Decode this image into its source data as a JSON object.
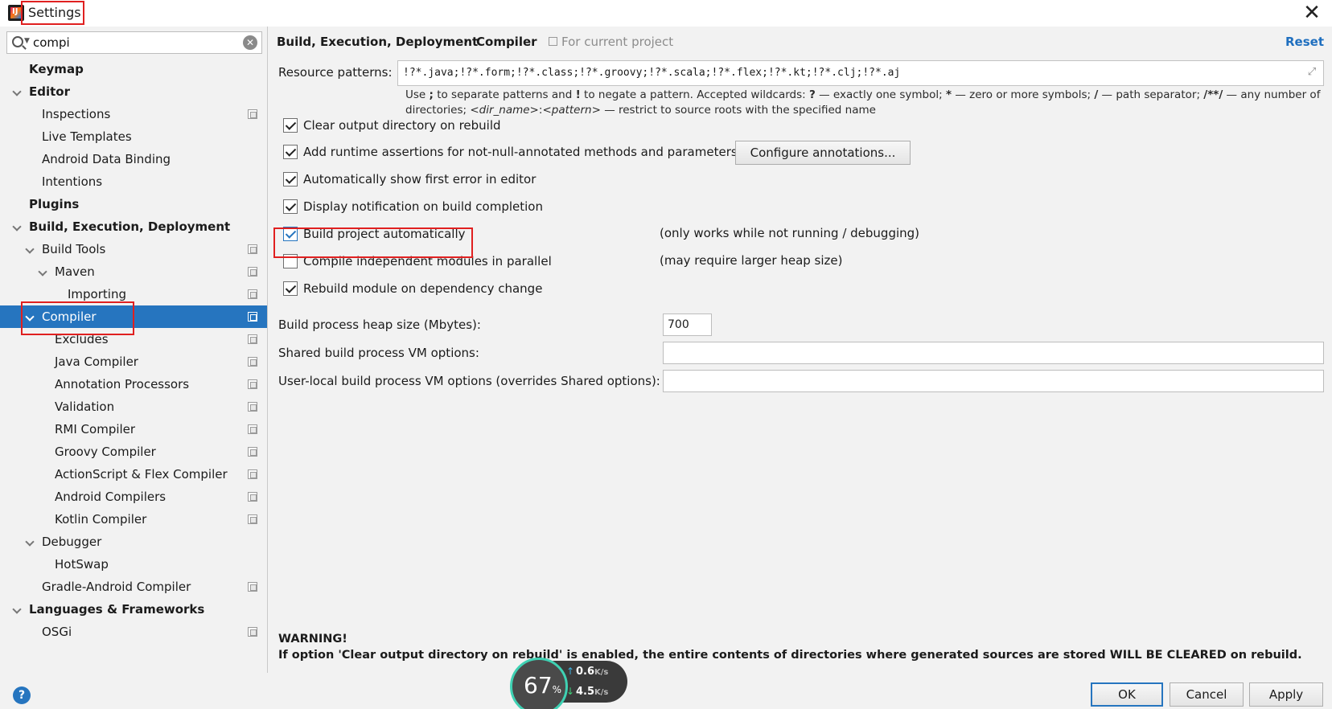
{
  "window": {
    "title": "Settings",
    "close_glyph": "✕"
  },
  "search": {
    "value": "compi",
    "clear_glyph": "✕"
  },
  "tree": [
    {
      "label": "Keymap",
      "bold": true
    },
    {
      "label": "Editor",
      "bold": true
    },
    {
      "label": "Inspections"
    },
    {
      "label": "Live Templates"
    },
    {
      "label": "Android Data Binding"
    },
    {
      "label": "Intentions"
    },
    {
      "label": "Plugins",
      "bold": true
    },
    {
      "label": "Build, Execution, Deployment",
      "bold": true
    },
    {
      "label": "Build Tools"
    },
    {
      "label": "Maven"
    },
    {
      "label": "Importing"
    },
    {
      "label": "Compiler",
      "selected": true
    },
    {
      "label": "Excludes"
    },
    {
      "label": "Java Compiler"
    },
    {
      "label": "Annotation Processors"
    },
    {
      "label": "Validation"
    },
    {
      "label": "RMI Compiler"
    },
    {
      "label": "Groovy Compiler"
    },
    {
      "label": "ActionScript & Flex Compiler"
    },
    {
      "label": "Android Compilers"
    },
    {
      "label": "Kotlin Compiler"
    },
    {
      "label": "Debugger"
    },
    {
      "label": "HotSwap"
    },
    {
      "label": "Gradle-Android Compiler"
    },
    {
      "label": "Languages & Frameworks",
      "bold": true
    },
    {
      "label": "OSGi"
    }
  ],
  "header": {
    "crumb_parent": "Build, Execution, Deployment",
    "crumb_sep": "›",
    "crumb_current": "Compiler",
    "scope": "For current project",
    "reset": "Reset"
  },
  "resource": {
    "label": "Resource patterns:",
    "value": "!?*.java;!?*.form;!?*.class;!?*.groovy;!?*.scala;!?*.flex;!?*.kt;!?*.clj;!?*.aj",
    "expand_glyph": "⤢",
    "hint_1": "Use ",
    "hint_semi": ";",
    "hint_2": " to separate patterns and ",
    "hint_bang": "!",
    "hint_3": " to negate a pattern. Accepted wildcards: ",
    "hint_q": "?",
    "hint_4": " — exactly one symbol; ",
    "hint_star": "*",
    "hint_5": " — zero or more symbols; ",
    "hint_slash": "/",
    "hint_6": " — path separator; ",
    "hint_any": "/**/",
    "hint_7": " — any number of directories; ",
    "hint_dir": "<dir_name>",
    "hint_colon": ":",
    "hint_pat": "<pattern>",
    "hint_8": " — restrict to source roots with the specified name"
  },
  "options": {
    "clear_output": {
      "label": "Clear output directory on rebuild",
      "checked": true
    },
    "runtime_assertions": {
      "label": "Add runtime assertions for not-null-annotated methods and parameters",
      "checked": true
    },
    "configure_annotations": "Configure annotations...",
    "show_first_error": {
      "label": "Automatically show first error in editor",
      "checked": true
    },
    "notify_build": {
      "label": "Display notification on build completion",
      "checked": true
    },
    "build_auto": {
      "label": "Build project automatically",
      "checked": true,
      "note": "(only works while not running / debugging)"
    },
    "compile_parallel": {
      "label": "Compile independent modules in parallel",
      "checked": false,
      "note": "(may require larger heap size)"
    },
    "rebuild_dep": {
      "label": "Rebuild module on dependency change",
      "checked": true
    }
  },
  "fields": {
    "heap_label": "Build process heap size (Mbytes):",
    "heap_value": "700",
    "shared_vm_label": "Shared build process VM options:",
    "shared_vm_value": "",
    "user_vm_label": "User-local build process VM options (overrides Shared options):",
    "user_vm_value": ""
  },
  "warning": {
    "title": "WARNING!",
    "text": "If option 'Clear output directory on rebuild' is enabled, the entire contents of directories where generated sources are stored WILL BE CLEARED on rebuild."
  },
  "buttons": {
    "help": "?",
    "ok": "OK",
    "cancel": "Cancel",
    "apply": "Apply"
  },
  "net_widget": {
    "percent": "67",
    "percent_unit": "%",
    "up": "0.6",
    "down": "4.5",
    "unit": "K/s",
    "up_glyph": "↑",
    "down_glyph": "↓"
  },
  "colors": {
    "selection": "#2675bf",
    "annotation": "#e02020",
    "link": "#1f6fbf"
  }
}
